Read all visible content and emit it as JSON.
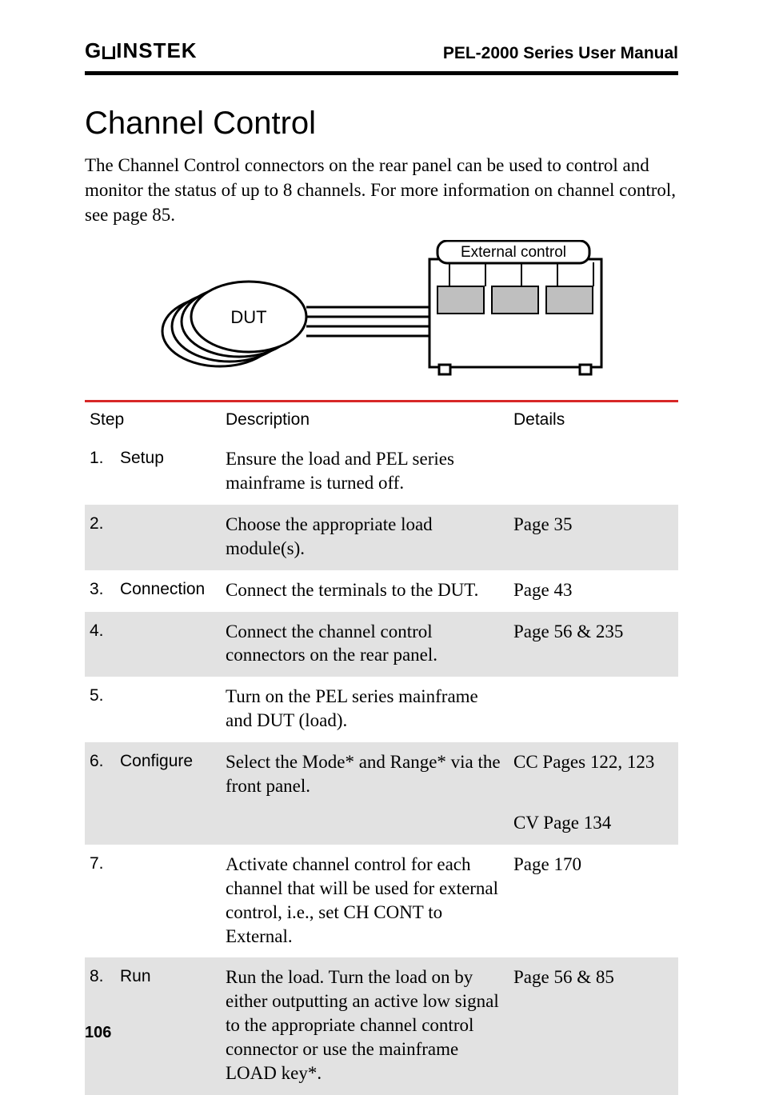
{
  "header": {
    "brand": "GWINSTEK",
    "manual_title": "PEL-2000 Series User Manual"
  },
  "section": {
    "title": "Channel Control",
    "intro": "The Channel Control connectors on the rear panel can be used to control and monitor the status of up to 8 channels. For more information on channel control, see page 85."
  },
  "diagram": {
    "dut_label": "DUT",
    "controller_label": "External control"
  },
  "table": {
    "headers": {
      "step": "Step",
      "description": "Description",
      "details": "Details"
    },
    "rows": [
      {
        "num": "1.",
        "label": "Setup",
        "desc": "Ensure the load and PEL series mainframe is turned off.",
        "details": "",
        "shade": false
      },
      {
        "num": "2.",
        "label": "",
        "desc": "Choose the appropriate load module(s).",
        "details": "Page 35",
        "shade": true
      },
      {
        "num": "3.",
        "label": "Connection",
        "desc": "Connect the terminals to the DUT.",
        "details": "Page 43",
        "shade": false
      },
      {
        "num": "4.",
        "label": "",
        "desc": "Connect the channel control connectors on the rear panel.",
        "details": "Page 56 & 235",
        "shade": true
      },
      {
        "num": "5.",
        "label": "",
        "desc": "Turn on the PEL series mainframe and DUT (load).",
        "details": "",
        "shade": false
      },
      {
        "num": "6.",
        "label": "Configure",
        "desc": "Select the Mode* and Range* via the front panel.",
        "details": "CC Pages 122, 123",
        "shade": true,
        "extra_details": "CV Page 134"
      },
      {
        "num": "7.",
        "label": "",
        "desc": "Activate channel control for each channel that will be used for external control, i.e., set CH CONT to External.",
        "details": "Page 170",
        "shade": false
      },
      {
        "num": "8.",
        "label": "Run",
        "desc": "Run the load. Turn the load on by either outputting an active low signal to the appropriate channel control connector or use the mainframe LOAD key*.",
        "details": "Page 56 & 85",
        "shade": true
      }
    ]
  },
  "page_number": "106"
}
